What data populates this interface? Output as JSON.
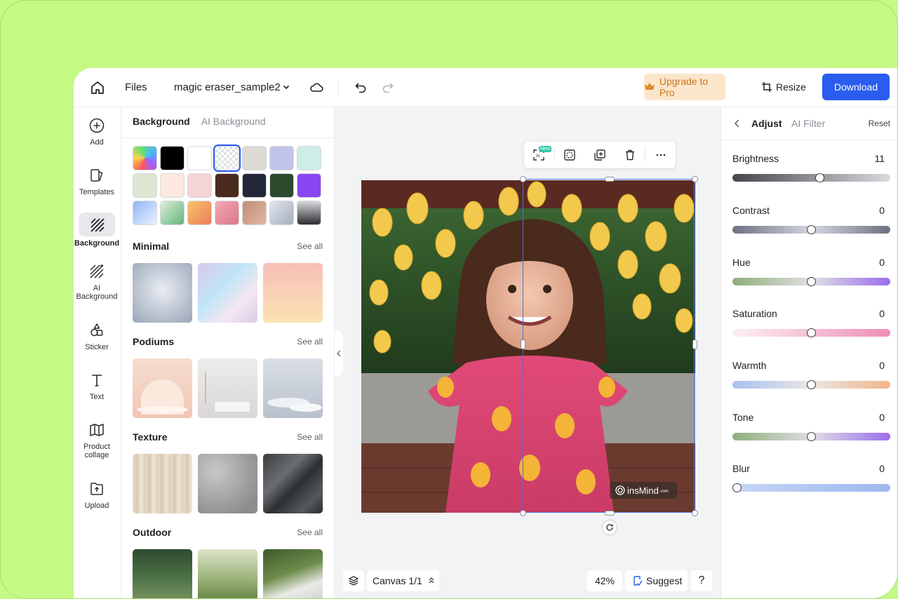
{
  "topbar": {
    "files_label": "Files",
    "doc_name": "magic eraser_sample2",
    "upgrade_label": "Upgrade to Pro",
    "resize_label": "Resize",
    "download_label": "Download"
  },
  "rail": {
    "items": [
      {
        "label": "Add",
        "icon": "plus-circle-icon"
      },
      {
        "label": "Templates",
        "icon": "templates-icon"
      },
      {
        "label": "Background",
        "icon": "background-icon",
        "active": true
      },
      {
        "label": "AI Background",
        "icon": "ai-background-icon"
      },
      {
        "label": "Sticker",
        "icon": "sticker-icon"
      },
      {
        "label": "Text",
        "icon": "text-icon"
      },
      {
        "label": "Product collage",
        "icon": "collage-icon"
      },
      {
        "label": "Upload",
        "icon": "upload-icon"
      }
    ]
  },
  "panel": {
    "tab_active": "Background",
    "tab_inactive": "AI Background",
    "swatch_colors": [
      "rainbow",
      "#000000",
      "#ffffff",
      "transparent",
      "#dcd9d6",
      "#c1c4ea",
      "#cdeee6",
      "#dce6d2",
      "#fde9dd",
      "#f5d4d4",
      "#4a2a1c",
      "#232838",
      "#2c4a2d",
      "#8a45f2",
      "grad-blue",
      "grad-green",
      "grad-orange",
      "grad-rose",
      "grad-tan",
      "grad-silver",
      "grad-dark"
    ],
    "sections": [
      {
        "title": "Minimal",
        "see_all": "See all"
      },
      {
        "title": "Podiums",
        "see_all": "See all"
      },
      {
        "title": "Texture",
        "see_all": "See all"
      },
      {
        "title": "Outdoor",
        "see_all": "See all"
      }
    ]
  },
  "canvas": {
    "watermark": "insMind",
    "watermark_suffix": ".com",
    "new_badge": "New",
    "canvas_label": "Canvas 1/1",
    "zoom": "42%",
    "suggest_label": "Suggest",
    "help_label": "?"
  },
  "adjust": {
    "tab_active": "Adjust",
    "tab_inactive": "AI Filter",
    "reset_label": "Reset",
    "controls": [
      {
        "label": "Brightness",
        "value": "11",
        "fraction": 0.555
      },
      {
        "label": "Contrast",
        "value": "0",
        "fraction": 0.5
      },
      {
        "label": "Hue",
        "value": "0",
        "fraction": 0.5
      },
      {
        "label": "Saturation",
        "value": "0",
        "fraction": 0.5
      },
      {
        "label": "Warmth",
        "value": "0",
        "fraction": 0.5
      },
      {
        "label": "Tone",
        "value": "0",
        "fraction": 0.5
      },
      {
        "label": "Blur",
        "value": "0",
        "fraction": 0.0
      }
    ]
  },
  "colors": {
    "accent": "#2a5cf0",
    "page_bg": "#c5f986",
    "upgrade_bg": "#fbe6cc",
    "upgrade_text": "#c8741b"
  }
}
